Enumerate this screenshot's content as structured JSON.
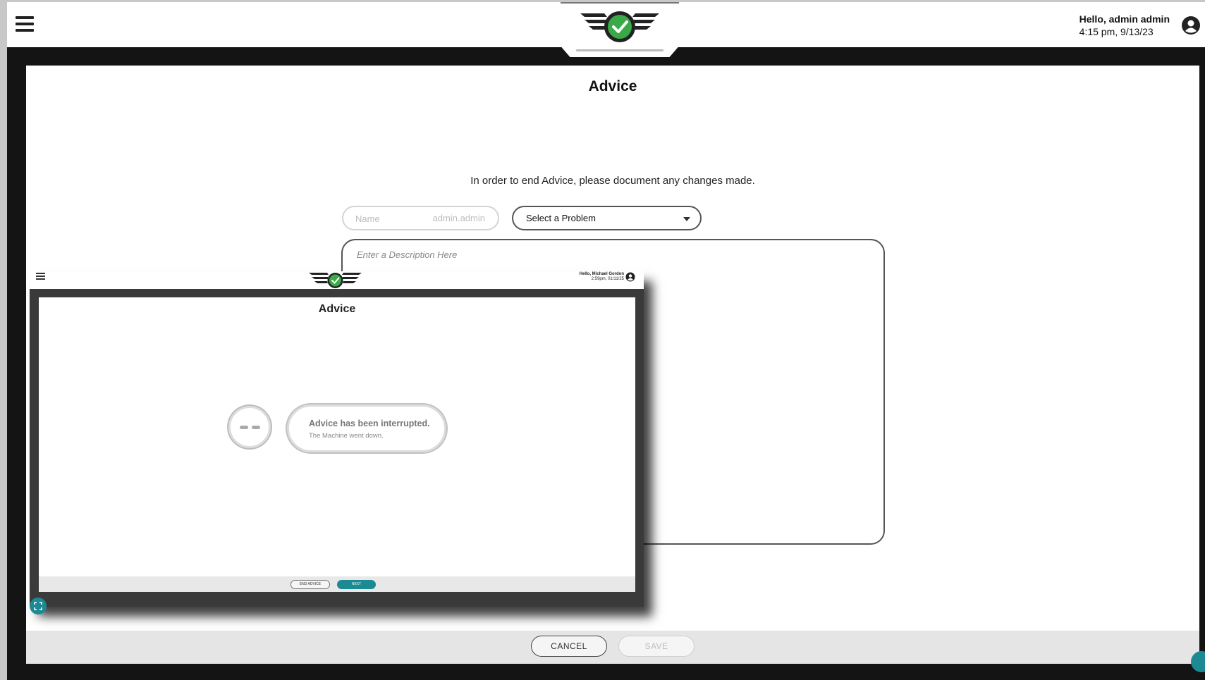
{
  "header": {
    "greeting": "Hello, admin admin",
    "datetime": "4:15 pm, 9/13/23"
  },
  "main": {
    "title": "Advice",
    "instruction": "In order to end Advice, please document any changes made.",
    "name_field": {
      "placeholder": "Name",
      "value": "admin.admin"
    },
    "problem_select": {
      "selected": "Select a Problem"
    },
    "description": {
      "placeholder": "Enter a Description Here"
    },
    "footer": {
      "cancel_label": "CANCEL",
      "save_label": "SAVE"
    }
  },
  "embedded_screenshot": {
    "greeting": "Hello, Michael Gordon",
    "datetime": "2:59pm, 01/11/25",
    "title": "Advice",
    "message_title": "Advice has been interrupted.",
    "message_body": "The Machine went down.",
    "end_advice_label": "END ADVICE",
    "next_label": "NEXT"
  },
  "colors": {
    "accent_teal": "#1c8a93",
    "logo_green": "#3aaa48",
    "dark_frame": "#141414"
  }
}
